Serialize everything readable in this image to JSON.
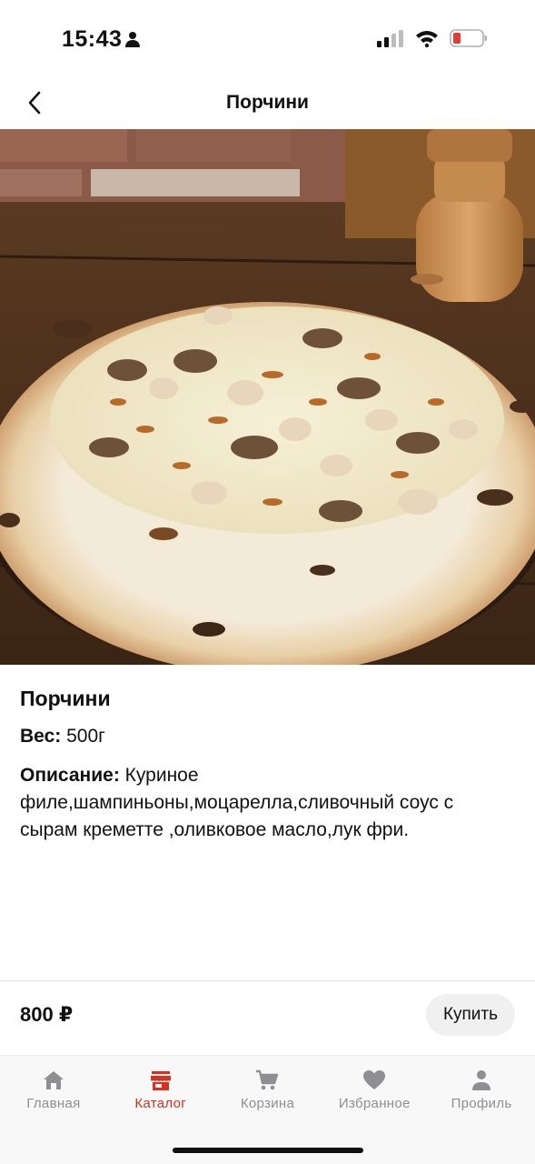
{
  "status": {
    "time": "15:43"
  },
  "nav": {
    "title": "Порчини"
  },
  "product": {
    "name": "Порчини",
    "weight_label": "Вес:",
    "weight_value": "500г",
    "description_label": "Описание:",
    "description_value": "Куриное филе,шампиньоны,моцарелла,сливочный соус с сырам креметте ,оливковое масло,лук фри."
  },
  "buy": {
    "price": "800 ₽",
    "button_label": "Купить"
  },
  "tabs": [
    {
      "label": "Главная",
      "icon": "home-icon"
    },
    {
      "label": "Каталог",
      "icon": "store-icon"
    },
    {
      "label": "Корзина",
      "icon": "cart-icon"
    },
    {
      "label": "Избранное",
      "icon": "heart-icon"
    },
    {
      "label": "Профиль",
      "icon": "person-icon"
    }
  ],
  "colors": {
    "accent": "#d9301f",
    "tab_inactive": "#8e8e93",
    "battery_low": "#e53935"
  }
}
